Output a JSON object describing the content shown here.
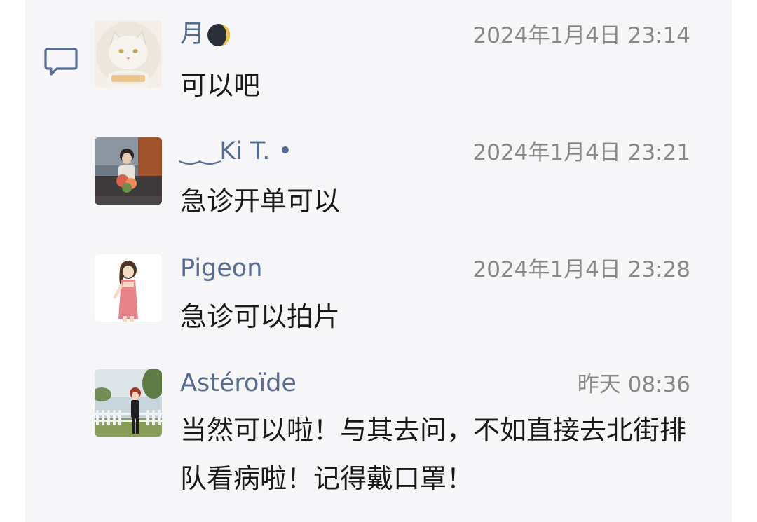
{
  "comments": [
    {
      "author": "月",
      "author_emoji": "waning-crescent-moon-emoji",
      "time": "2024年1月4日 23:14",
      "text": "可以吧",
      "avatar": "cat-avatar"
    },
    {
      "author": "‿‿Ki T. •",
      "time": "2024年1月4日 23:21",
      "text": "急诊开单可以",
      "avatar": "girl-with-flowers-avatar"
    },
    {
      "author": "Pigeon",
      "time": "2024年1月4日 23:28",
      "text": "急诊可以拍片",
      "avatar": "anime-girl-avatar"
    },
    {
      "author": "Astéroïde",
      "time": "昨天 08:36",
      "text": "当然可以啦！与其去问，不如直接去北街排队看病啦！记得戴口罩！",
      "avatar": "girl-by-fence-avatar"
    }
  ],
  "colors": {
    "name": "#576b95",
    "time": "#888888",
    "text": "#191919",
    "panel": "#f6f6f8",
    "icon": "#576b95"
  }
}
